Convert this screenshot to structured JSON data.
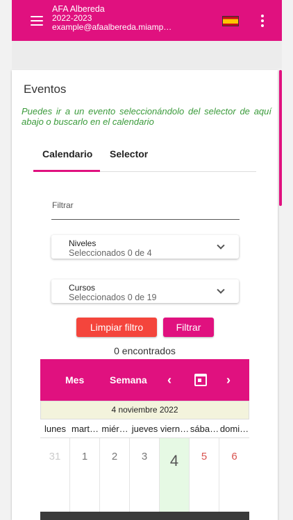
{
  "topbar": {
    "title": "AFA Albereda",
    "year": "2022-2023",
    "email": "example@afaalbereda.miamp…",
    "colors": {
      "accent": "#e0117f"
    }
  },
  "events": {
    "title": "Eventos",
    "help": "Puedes ir a un evento seleccionándolo del selector de aquí abajo o buscarlo en el calendario",
    "tabs": [
      "Calendario",
      "Selector"
    ],
    "active_tab": "Calendario"
  },
  "filter": {
    "label": "Filtrar",
    "levels": {
      "label": "Niveles",
      "value": "Seleccionados 0 de 4"
    },
    "courses": {
      "label": "Cursos",
      "value": "Seleccionados 0 de 19"
    },
    "clear_label": "Limpiar filtro",
    "apply_label": "Filtrar",
    "found": "0 encontrados"
  },
  "calendar": {
    "month_label": "Mes",
    "week_label": "Semana",
    "prev_label": "‹",
    "next_label": "›",
    "date": "4 noviembre 2022",
    "weekdays": [
      "lunes",
      "mart…",
      "miér…",
      "jueves",
      "viern…",
      "sába…",
      "domi…"
    ],
    "days": [
      "31",
      "1",
      "2",
      "3",
      "4",
      "5",
      "6"
    ]
  }
}
